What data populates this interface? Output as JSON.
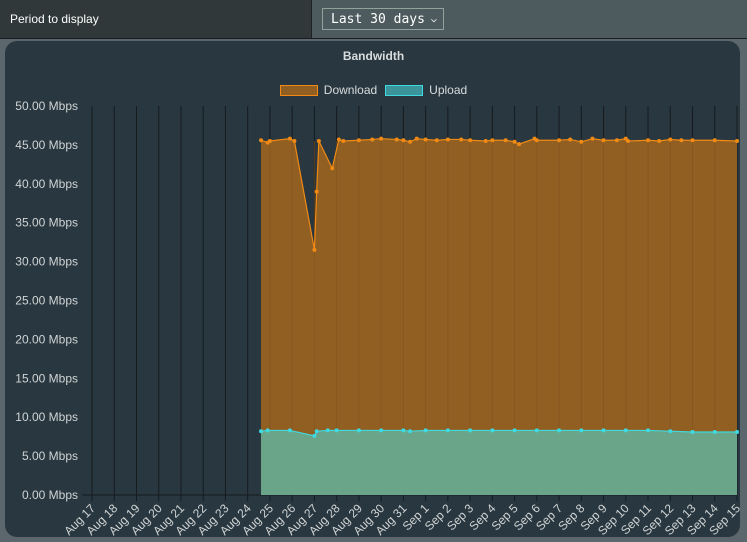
{
  "filter": {
    "label": "Period to display",
    "selected": "Last 30 days",
    "dropdown_icon": "chevron-down-icon"
  },
  "colors": {
    "download_fill": "#925f22",
    "download_line": "#f08a14",
    "upload_fill": "#6aa58a",
    "upload_line": "#3fd9e0",
    "grid": "#151b1f"
  },
  "chart_data": {
    "type": "area",
    "title": "Bandwidth",
    "xlabel": "",
    "ylabel": "",
    "legend_position": "top-center",
    "ylim": [
      0,
      50
    ],
    "y_ticks": [
      "0.00 Mbps",
      "5.00 Mbps",
      "10.00 Mbps",
      "15.00 Mbps",
      "20.00 Mbps",
      "25.00 Mbps",
      "30.00 Mbps",
      "35.00 Mbps",
      "40.00 Mbps",
      "45.00 Mbps",
      "50.00 Mbps"
    ],
    "categories": [
      "Aug 17",
      "Aug 18",
      "Aug 19",
      "Aug 20",
      "Aug 21",
      "Aug 22",
      "Aug 23",
      "Aug 24",
      "Aug 25",
      "Aug 26",
      "Aug 27",
      "Aug 28",
      "Aug 29",
      "Aug 30",
      "Aug 31",
      "Sep 1",
      "Sep 2",
      "Sep 3",
      "Sep 4",
      "Sep 5",
      "Sep 6",
      "Sep 7",
      "Sep 8",
      "Sep 9",
      "Sep 10",
      "Sep 11",
      "Sep 12",
      "Sep 13",
      "Sep 14",
      "Sep 15"
    ],
    "grid": true,
    "series": [
      {
        "name": "Download",
        "points": [
          [
            7.6,
            45.6
          ],
          [
            7.9,
            45.3
          ],
          [
            8.0,
            45.5
          ],
          [
            8.9,
            45.8
          ],
          [
            9.1,
            45.5
          ],
          [
            10.0,
            31.5
          ],
          [
            10.1,
            39.0
          ],
          [
            10.2,
            45.5
          ],
          [
            10.8,
            42.0
          ],
          [
            11.1,
            45.7
          ],
          [
            11.3,
            45.5
          ],
          [
            12.0,
            45.6
          ],
          [
            12.6,
            45.7
          ],
          [
            13.0,
            45.8
          ],
          [
            13.7,
            45.7
          ],
          [
            14.0,
            45.6
          ],
          [
            14.3,
            45.4
          ],
          [
            14.6,
            45.8
          ],
          [
            15.0,
            45.7
          ],
          [
            15.5,
            45.6
          ],
          [
            16.0,
            45.7
          ],
          [
            16.6,
            45.7
          ],
          [
            17.0,
            45.6
          ],
          [
            17.7,
            45.5
          ],
          [
            18.0,
            45.6
          ],
          [
            18.6,
            45.6
          ],
          [
            19.0,
            45.4
          ],
          [
            19.2,
            45.1
          ],
          [
            19.9,
            45.8
          ],
          [
            20.0,
            45.6
          ],
          [
            21.0,
            45.6
          ],
          [
            21.5,
            45.7
          ],
          [
            22.0,
            45.4
          ],
          [
            22.5,
            45.8
          ],
          [
            23.0,
            45.6
          ],
          [
            23.6,
            45.6
          ],
          [
            24.0,
            45.8
          ],
          [
            24.1,
            45.5
          ],
          [
            25.0,
            45.6
          ],
          [
            25.5,
            45.5
          ],
          [
            26.0,
            45.7
          ],
          [
            26.5,
            45.6
          ],
          [
            27.0,
            45.6
          ],
          [
            28.0,
            45.6
          ],
          [
            29.0,
            45.5
          ]
        ]
      },
      {
        "name": "Upload",
        "points": [
          [
            7.6,
            8.2
          ],
          [
            7.9,
            8.3
          ],
          [
            8.9,
            8.3
          ],
          [
            10.0,
            7.6
          ],
          [
            10.1,
            8.2
          ],
          [
            10.6,
            8.3
          ],
          [
            11.0,
            8.3
          ],
          [
            12.0,
            8.3
          ],
          [
            13.0,
            8.3
          ],
          [
            14.0,
            8.3
          ],
          [
            14.3,
            8.2
          ],
          [
            15.0,
            8.3
          ],
          [
            16.0,
            8.3
          ],
          [
            17.0,
            8.3
          ],
          [
            18.0,
            8.3
          ],
          [
            19.0,
            8.3
          ],
          [
            20.0,
            8.3
          ],
          [
            21.0,
            8.3
          ],
          [
            22.0,
            8.3
          ],
          [
            23.0,
            8.3
          ],
          [
            24.0,
            8.3
          ],
          [
            25.0,
            8.3
          ],
          [
            26.0,
            8.2
          ],
          [
            27.0,
            8.1
          ],
          [
            28.0,
            8.1
          ],
          [
            29.0,
            8.1
          ]
        ]
      }
    ]
  }
}
